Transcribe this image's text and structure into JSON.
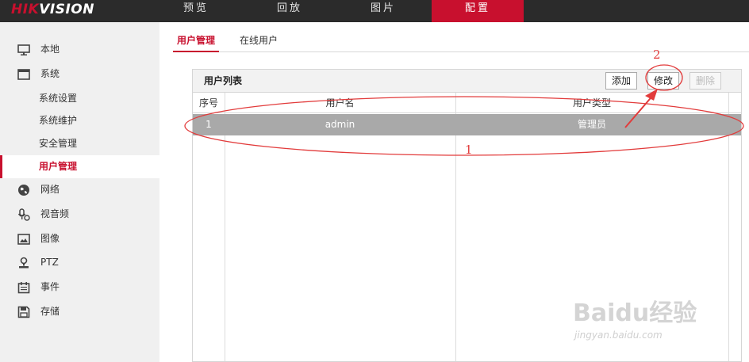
{
  "brand": {
    "hik": "HIK",
    "vision": "VISION"
  },
  "nav": {
    "tabs": [
      {
        "label": "预览"
      },
      {
        "label": "回放"
      },
      {
        "label": "图片"
      },
      {
        "label": "配置"
      }
    ],
    "active": "配置",
    "active_color": "#c8102e"
  },
  "sidebar": {
    "local": "本地",
    "system": "系统",
    "system_sub": [
      "系统设置",
      "系统维护",
      "安全管理",
      "用户管理"
    ],
    "network": "网络",
    "video_audio": "视音频",
    "image": "图像",
    "ptz": "PTZ",
    "event": "事件",
    "storage": "存储"
  },
  "subtabs": {
    "user_mgmt": "用户管理",
    "online_users": "在线用户"
  },
  "user_list": {
    "title": "用户列表",
    "add": "添加",
    "modify": "修改",
    "delete": "删除",
    "columns": [
      "序号",
      "用户名",
      "用户类型"
    ],
    "rows": [
      {
        "index": "1",
        "username": "admin",
        "type": "管理员"
      }
    ]
  },
  "annotations": {
    "one": "1",
    "two": "2",
    "color": "#e23b3b"
  },
  "watermark": {
    "big": "Baidu经验",
    "small": "jingyan.baidu.com"
  }
}
